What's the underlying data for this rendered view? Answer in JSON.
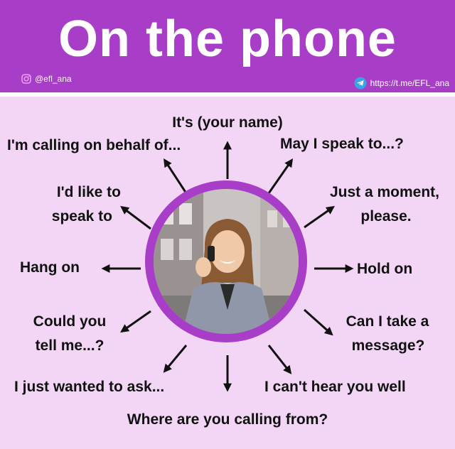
{
  "title": "On the phone",
  "social": {
    "instagram_handle": "@efl_ana",
    "telegram_link": "https://t.me/EFL_ana"
  },
  "phrases": {
    "top": "It's (your name)",
    "top_left": "I'm calling on behalf of...",
    "top_right": "May I speak to...?",
    "left_upper_1": "I'd like to",
    "left_upper_2": "speak to",
    "right_upper_1": "Just a moment,",
    "right_upper_2": "please.",
    "left": "Hang on",
    "right": "Hold on",
    "left_lower_1": "Could you",
    "left_lower_2": "tell me...?",
    "right_lower_1": "Can I take a",
    "right_lower_2": "message?",
    "bottom_left": "I just wanted to ask...",
    "bottom_right": "I can't hear you well",
    "bottom": "Where are you calling from?"
  },
  "colors": {
    "header": "#a83ec8",
    "background": "#f3d6f5",
    "ring": "#a83ec8"
  },
  "icons": [
    "instagram-icon",
    "telegram-icon",
    "arrow-icon"
  ]
}
